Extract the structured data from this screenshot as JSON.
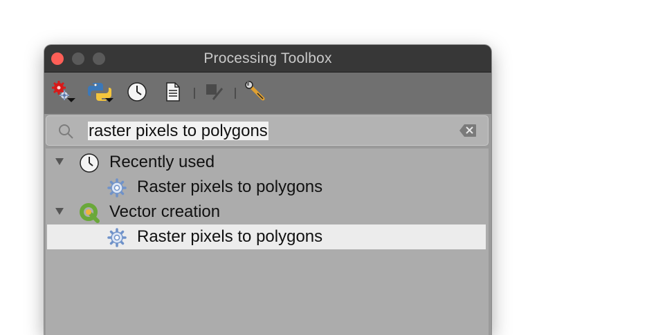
{
  "window": {
    "title": "Processing Toolbox"
  },
  "toolbar": {
    "buttons": [
      {
        "icon": "models-icon"
      },
      {
        "icon": "python-scripts-icon"
      },
      {
        "icon": "history-icon"
      },
      {
        "icon": "results-viewer-icon"
      },
      {
        "icon": "edit-features-in-place-icon"
      },
      {
        "icon": "options-icon"
      }
    ]
  },
  "search": {
    "value": "raster pixels to polygons"
  },
  "tree": {
    "groups": [
      {
        "label": "Recently used",
        "icon": "clock-icon",
        "items": [
          {
            "label": "Raster pixels to polygons",
            "icon": "algorithm-gear-icon"
          }
        ]
      },
      {
        "label": "Vector creation",
        "icon": "qgis-logo-icon",
        "items": [
          {
            "label": "Raster pixels to polygons",
            "icon": "algorithm-gear-icon",
            "selected": true
          }
        ]
      }
    ]
  },
  "colors": {
    "close": "#fe5f57",
    "titlebar": "#373737",
    "toolbar": "#707070",
    "tree_bg": "#acacac",
    "selection": "#ececec"
  }
}
